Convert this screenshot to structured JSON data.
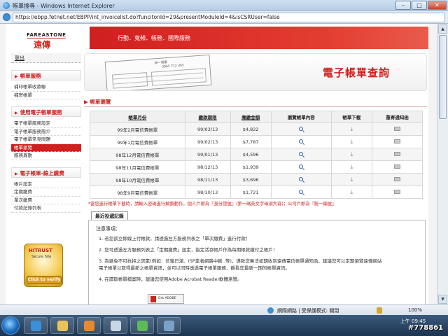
{
  "window": {
    "title": "帳單搜尋 - Windows Internet Explorer",
    "minimize": "–",
    "maximize": "□",
    "close": "✕"
  },
  "address": {
    "url": "https://ebpp.fetnet.net/EBPP/int_invoicelist.do?funcitonId=29&presentModuleId=4&isCSRUser=false"
  },
  "brand": {
    "logo_en": "FAREASTONE",
    "logo_zh": "遠傳"
  },
  "nav": {
    "text": "行動．寬頻．帳務．國際服務"
  },
  "sidebar": {
    "logout": "登出",
    "groups": [
      {
        "title": "帳單服務",
        "items": [
          "補印帳單收款聯",
          "補寄帳單"
        ]
      },
      {
        "title": "使用電子帳單服務",
        "items": [
          "電子帳單服務設定",
          "電子帳單服務簡介",
          "電子帳單常見問題",
          "帳單瀏覽",
          "服務異動"
        ]
      },
      {
        "title": "電子帳單-線上繳費",
        "items": [
          "帳戶設定",
          "定期繳費",
          "單次繳費",
          "付款記錄列表"
        ]
      }
    ],
    "active_item": "帳單瀏覽"
  },
  "badge": {
    "line1": "HiTRUST",
    "line2": "Secure Site",
    "button": "Click to verify"
  },
  "banner": {
    "title": "電子帳單查詢"
  },
  "invoice_art": {
    "label1": "統一發票",
    "label2": "0965 712 365"
  },
  "section": {
    "title": "帳單瀏覽"
  },
  "table": {
    "headers": [
      "帳單月份",
      "繳款期限",
      "應繳金額",
      "瀏覽帳單內容",
      "帳單下載",
      "重寄通知函"
    ],
    "rows": [
      [
        "99年2月電信費帳單",
        "99/03/13",
        "$4,822"
      ],
      [
        "99年1月電信費帳單",
        "99/02/13",
        "$7,787"
      ],
      [
        "98年12月電信費帳單",
        "99/01/13",
        "$4,596"
      ],
      [
        "98年11月電信費帳單",
        "98/12/13",
        "$1,939"
      ],
      [
        "98年10月電信費帳單",
        "98/11/13",
        "$3,696"
      ],
      [
        "98年9月電信費帳單",
        "98/10/13",
        "$1,721"
      ]
    ],
    "icons": {
      "view": "magnifier-icon",
      "download": "download-icon",
      "resend": "mail-icon"
    }
  },
  "note": {
    "red": "*當您進行帳單下載時，請輸入密碼進行解鎖動作。個人戶即為『身分證號』(第一碼英文字母須大寫)；公司戶即為『統一編號』"
  },
  "tab": {
    "label": "最近投遞記錄"
  },
  "notice": {
    "title": "注意事項：",
    "items": [
      "1.  若您欲立即線上付帳款，請透過左方服務列表之「單次繳費」進行付款！",
      "2.  您可透過左方服務列表之「定期繳費」設定，指定活存帳戶作為每期帳款繳付之帳戶！",
      "3.  為避免不可抗拒之因素(例如：信箱已滿、ISP業者網路中斷..等)，導致您無法如期收到遠傳電信帳單通知函，建議您可以定期瀏覽遠傳網站",
      "     電子帳單以取得最新之帳單資訊，並可以同時透過電子帳單服務，觀看您最新一期的帳單資訊。",
      "4.  在讀取帳單檔案時，建議您使用Adobe Acrobat Reader軟體瀏覽。"
    ],
    "pdf_button": "Get ADOBE READER"
  },
  "status": {
    "zone": "網際網路 | 受保護模式: 關閉",
    "zoom": "100%"
  },
  "taskbar": {
    "time": "上午 09:45",
    "watermark": "#778861"
  }
}
